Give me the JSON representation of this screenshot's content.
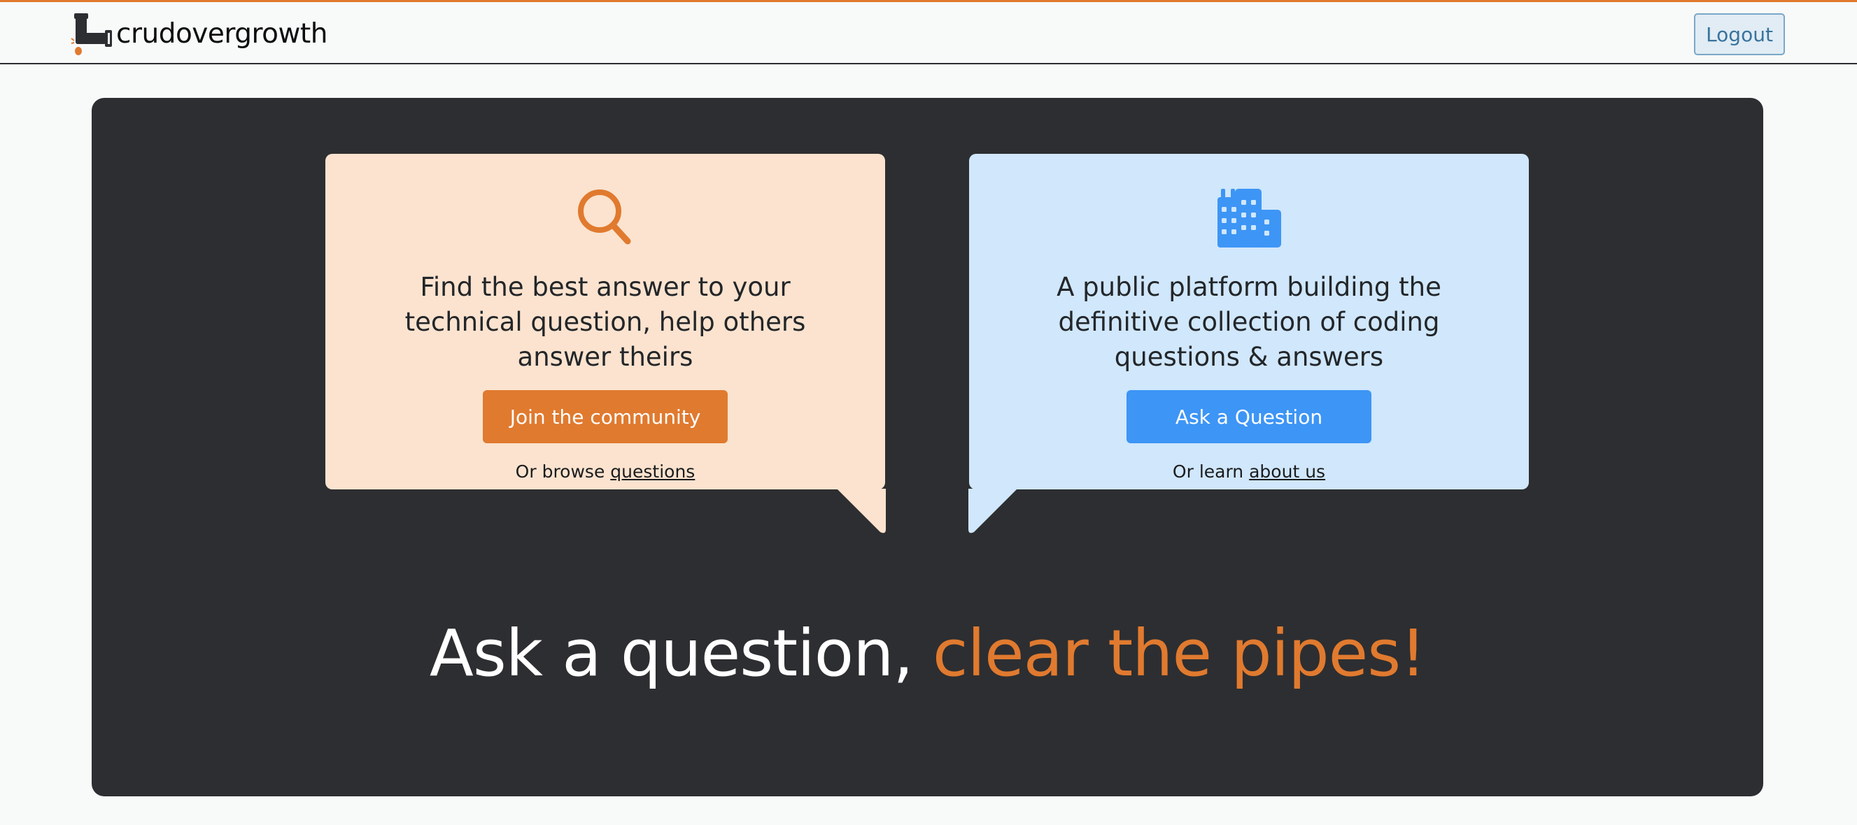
{
  "header": {
    "logo_text": "crudovergrowth",
    "logout_label": "Logout"
  },
  "hero": {
    "left_card": {
      "icon": "search-icon",
      "text": "Find the best answer to your technical question, help others answer theirs",
      "button_label": "Join the community",
      "foot_prefix": "Or browse ",
      "foot_link": "questions"
    },
    "right_card": {
      "icon": "building-icon",
      "text": "A public platform building the definitive collection of coding questions & answers",
      "button_label": "Ask a Question",
      "foot_prefix": "Or learn ",
      "foot_link": "about us"
    },
    "headline_part1": "Ask a question, ",
    "headline_part2": "clear the pipes!"
  },
  "colors": {
    "accent_orange": "#e07a2f",
    "accent_blue": "#3d95f5",
    "hero_bg": "#2d2e31",
    "left_card_bg": "#fbe3cf",
    "right_card_bg": "#d0e7fc"
  }
}
